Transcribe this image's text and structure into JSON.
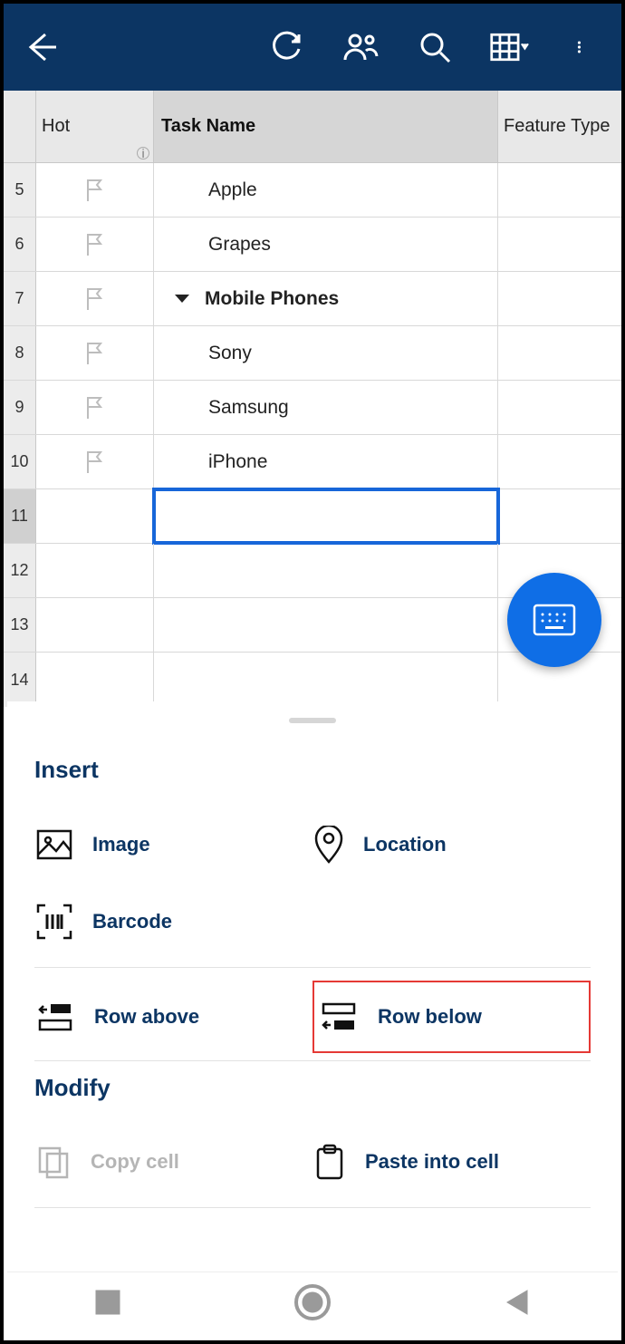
{
  "columns": {
    "rownum": "",
    "hot": "Hot",
    "task": "Task Name",
    "feature": "Feature Type"
  },
  "rows": [
    {
      "num": "5",
      "task": "Apple",
      "parent": false,
      "flag": true,
      "selected": false
    },
    {
      "num": "6",
      "task": "Grapes",
      "parent": false,
      "flag": true,
      "selected": false
    },
    {
      "num": "7",
      "task": "Mobile Phones",
      "parent": true,
      "flag": true,
      "selected": false
    },
    {
      "num": "8",
      "task": "Sony",
      "parent": false,
      "flag": true,
      "selected": false
    },
    {
      "num": "9",
      "task": "Samsung",
      "parent": false,
      "flag": true,
      "selected": false
    },
    {
      "num": "10",
      "task": "iPhone",
      "parent": false,
      "flag": true,
      "selected": false
    },
    {
      "num": "11",
      "task": "",
      "parent": false,
      "flag": false,
      "selected": true
    },
    {
      "num": "12",
      "task": "",
      "parent": false,
      "flag": false,
      "selected": false
    },
    {
      "num": "13",
      "task": "",
      "parent": false,
      "flag": false,
      "selected": false
    },
    {
      "num": "14",
      "task": "",
      "parent": false,
      "flag": false,
      "selected": false
    }
  ],
  "sheet": {
    "insert": {
      "title": "Insert",
      "image": "Image",
      "location": "Location",
      "barcode": "Barcode",
      "row_above": "Row above",
      "row_below": "Row below"
    },
    "modify": {
      "title": "Modify",
      "copy_cell": "Copy cell",
      "paste": "Paste into cell"
    }
  }
}
